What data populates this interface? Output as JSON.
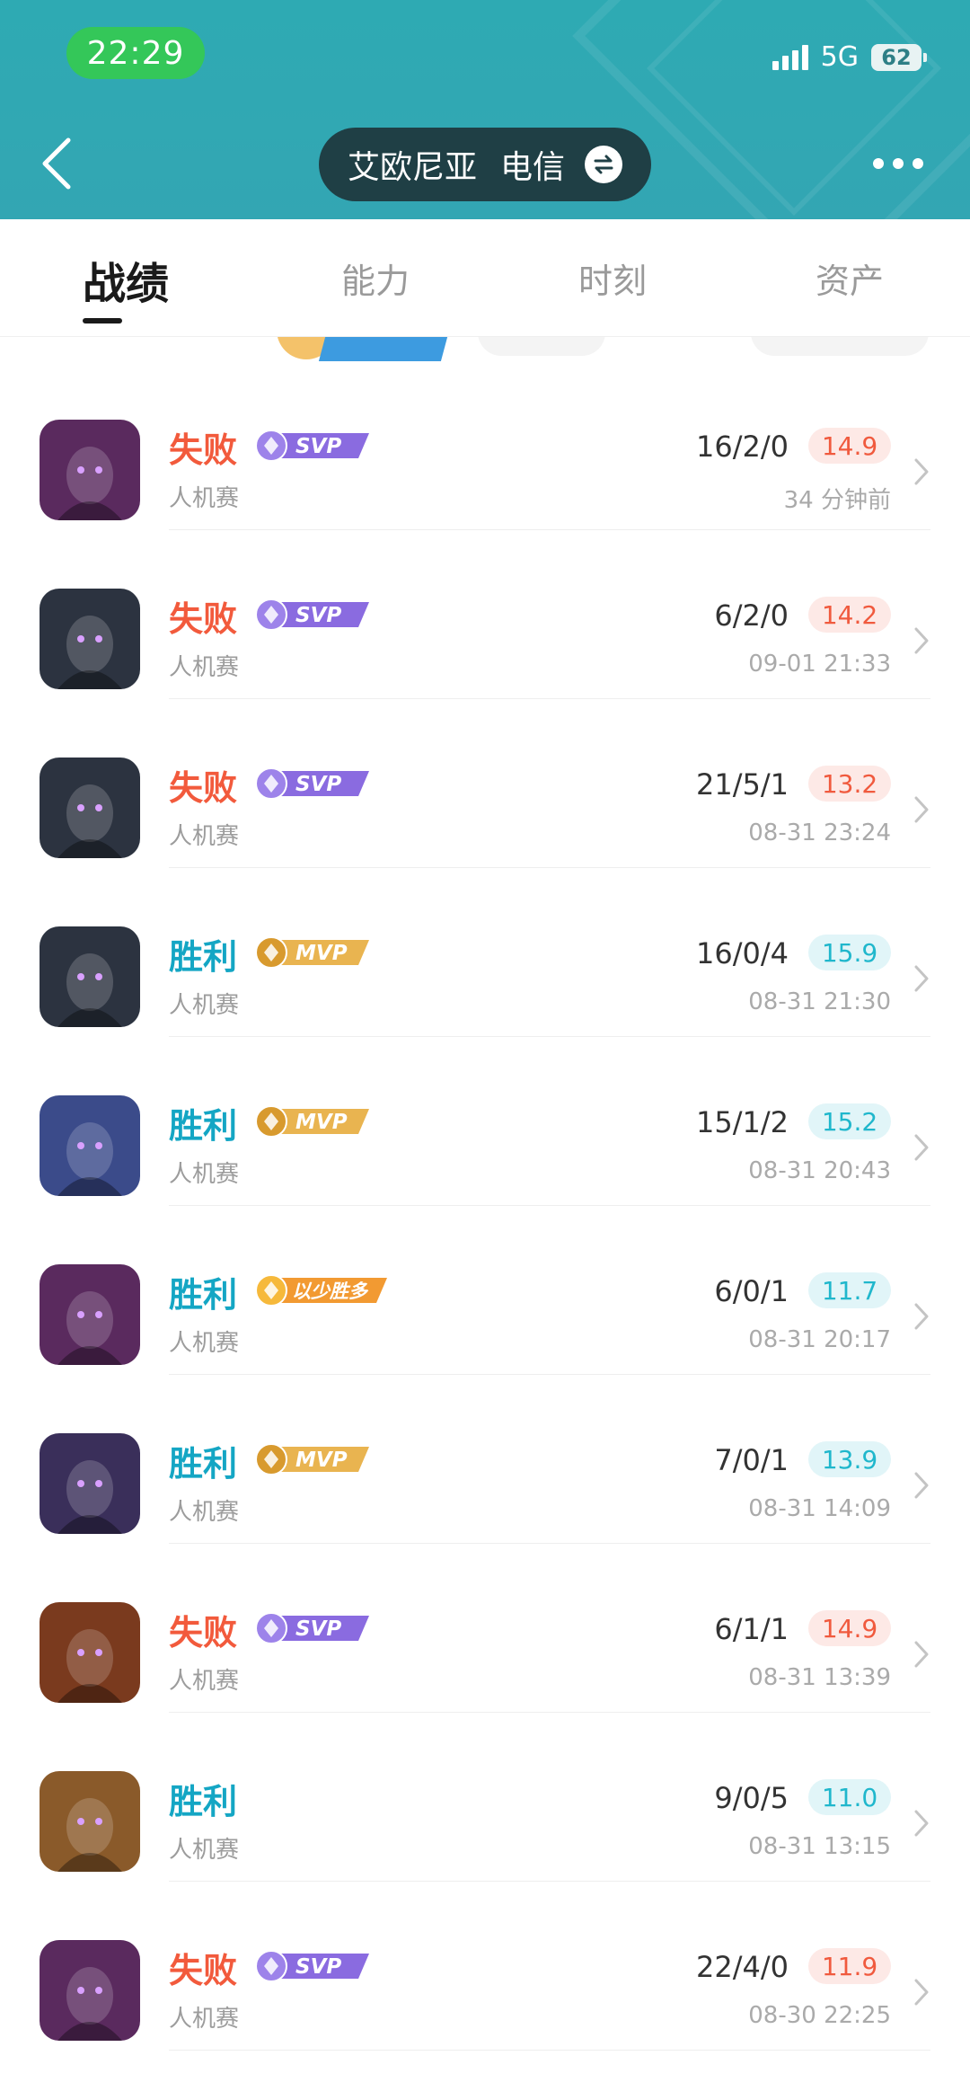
{
  "status_bar": {
    "time": "22:29",
    "network": "5G",
    "battery": "62"
  },
  "nav": {
    "server": "艾欧尼亚",
    "carrier": "电信"
  },
  "tabs": [
    {
      "label": "战绩",
      "active": true
    },
    {
      "label": "能力",
      "active": false
    },
    {
      "label": "时刻",
      "active": false
    },
    {
      "label": "资产",
      "active": false
    }
  ],
  "matches": [
    {
      "result": "失败",
      "outcome": "loss",
      "badge": "SVP",
      "mode": "人机赛",
      "kda": "16/2/0",
      "score": "14.9",
      "time": "34 分钟前",
      "hero_color": "#5a2a5e"
    },
    {
      "result": "失败",
      "outcome": "loss",
      "badge": "SVP",
      "mode": "人机赛",
      "kda": "6/2/0",
      "score": "14.2",
      "time": "09-01 21:33",
      "hero_color": "#2c3340"
    },
    {
      "result": "失败",
      "outcome": "loss",
      "badge": "SVP",
      "mode": "人机赛",
      "kda": "21/5/1",
      "score": "13.2",
      "time": "08-31 23:24",
      "hero_color": "#2c3340"
    },
    {
      "result": "胜利",
      "outcome": "win",
      "badge": "MVP",
      "mode": "人机赛",
      "kda": "16/0/4",
      "score": "15.9",
      "time": "08-31 21:30",
      "hero_color": "#2c3340"
    },
    {
      "result": "胜利",
      "outcome": "win",
      "badge": "MVP",
      "mode": "人机赛",
      "kda": "15/1/2",
      "score": "15.2",
      "time": "08-31 20:43",
      "hero_color": "#3b4b8a"
    },
    {
      "result": "胜利",
      "outcome": "win",
      "badge": "以少胜多",
      "mode": "人机赛",
      "kda": "6/0/1",
      "score": "11.7",
      "time": "08-31 20:17",
      "hero_color": "#5a2a5e"
    },
    {
      "result": "胜利",
      "outcome": "win",
      "badge": "MVP",
      "mode": "人机赛",
      "kda": "7/0/1",
      "score": "13.9",
      "time": "08-31 14:09",
      "hero_color": "#3a2f5a"
    },
    {
      "result": "失败",
      "outcome": "loss",
      "badge": "SVP",
      "mode": "人机赛",
      "kda": "6/1/1",
      "score": "14.9",
      "time": "08-31 13:39",
      "hero_color": "#7a3a1e"
    },
    {
      "result": "胜利",
      "outcome": "win",
      "badge": "",
      "mode": "人机赛",
      "kda": "9/0/5",
      "score": "11.0",
      "time": "08-31 13:15",
      "hero_color": "#8a5a2a"
    },
    {
      "result": "失败",
      "outcome": "loss",
      "badge": "SVP",
      "mode": "人机赛",
      "kda": "22/4/0",
      "score": "11.9",
      "time": "08-30 22:25",
      "hero_color": "#5a2a5e"
    }
  ]
}
